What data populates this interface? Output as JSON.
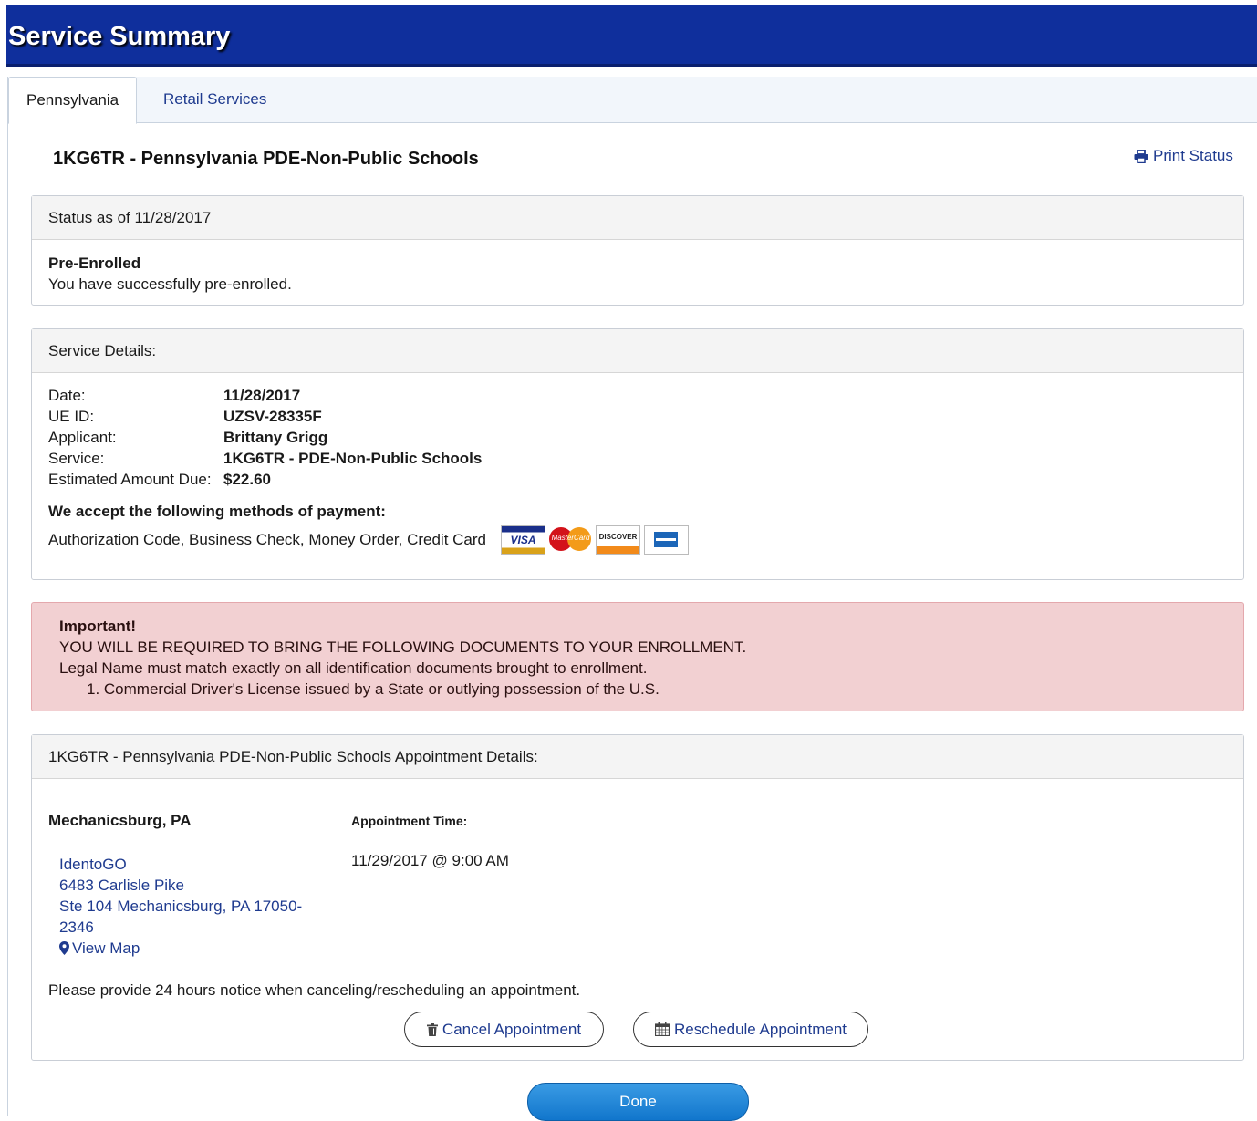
{
  "header": {
    "title": "Service Summary"
  },
  "tabs": [
    {
      "label": "Pennsylvania"
    },
    {
      "label": "Retail Services"
    }
  ],
  "service": {
    "title": "1KG6TR - Pennsylvania PDE-Non-Public Schools",
    "print_label": "Print Status"
  },
  "status": {
    "heading": "Status as of 11/28/2017",
    "title": "Pre-Enrolled",
    "text": "You have successfully pre-enrolled."
  },
  "details": {
    "heading": "Service Details:",
    "rows": [
      {
        "label": "Date:",
        "value": "11/28/2017"
      },
      {
        "label": "UE ID:",
        "value": "UZSV-28335F"
      },
      {
        "label": "Applicant:",
        "value": "Brittany Grigg"
      },
      {
        "label": "Service:",
        "value": "1KG6TR - PDE-Non-Public Schools"
      },
      {
        "label": "Estimated Amount Due:",
        "value": "$22.60"
      }
    ],
    "payment_heading": "We accept the following methods of payment:",
    "payment_methods": "Authorization Code, Business Check, Money Order, Credit Card",
    "card_logos": [
      "VISA",
      "MasterCard",
      "DISCOVER",
      "American Express"
    ]
  },
  "alert": {
    "title": "Important!",
    "line1": "YOU WILL BE REQUIRED TO BRING THE FOLLOWING DOCUMENTS TO YOUR ENROLLMENT.",
    "line2": "Legal Name must match exactly on all identification documents brought to enrollment.",
    "item1": "1. Commercial Driver's License issued by a State or outlying possession of the U.S."
  },
  "appointment": {
    "heading": "1KG6TR - Pennsylvania PDE-Non-Public Schools Appointment Details:",
    "location_name": "Mechanicsburg, PA",
    "time_label": "Appointment Time:",
    "time_value": "11/29/2017 @ 9:00 AM",
    "address_line1": "IdentoGO",
    "address_line2": "6483 Carlisle Pike",
    "address_line3": "Ste 104 Mechanicsburg, PA 17050-",
    "address_line4": "2346",
    "map_label": "View Map",
    "notice": "Please provide 24 hours notice when canceling/rescheduling an appointment.",
    "cancel_label": "Cancel Appointment",
    "reschedule_label": "Reschedule Appointment"
  },
  "done_label": "Done",
  "icons": {
    "print": "printer-icon",
    "map": "map-marker-icon",
    "cancel": "trash-icon",
    "reschedule": "calendar-icon"
  },
  "colors": {
    "header_bg": "#0f2f9c",
    "link": "#1f3b8f",
    "alert_bg": "#f2d0d2",
    "done_bg": "#1176cc"
  }
}
